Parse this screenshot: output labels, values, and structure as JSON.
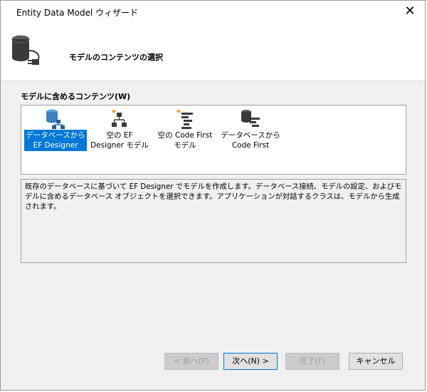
{
  "window": {
    "title": "Entity Data Model ウィザード",
    "close_glyph": "✕"
  },
  "header": {
    "title": "モデルのコンテンツの選択",
    "icon": "database-plug-icon"
  },
  "contents": {
    "label": "モデルに含めるコンテンツ(W)",
    "items": [
      {
        "label": "データベースから EF Designer",
        "icon": "database-ef-designer-icon",
        "selected": true
      },
      {
        "label": "空の EF Designer モデル",
        "icon": "empty-ef-designer-icon",
        "selected": false
      },
      {
        "label": "空の Code First モデル",
        "icon": "empty-code-first-icon",
        "selected": false
      },
      {
        "label": "データベースから Code First",
        "icon": "database-code-first-icon",
        "selected": false
      }
    ]
  },
  "description": "既存のデータベースに基づいて EF Designer でモデルを作成します。データベース接続、モデルの設定、およびモデルに含めるデータベース オブジェクトを選択できます。アプリケーションが対話するクラスは、モデルから生成されます。",
  "buttons": {
    "back": "< 前へ(P)",
    "next": "次へ(N) >",
    "finish": "完了(F)",
    "cancel": "キャンセル"
  },
  "colors": {
    "selection": "#0078d7",
    "window_bg": "#f0f0f0",
    "db_icon": "#3a3a3a",
    "accent_orange": "#f0a030"
  }
}
